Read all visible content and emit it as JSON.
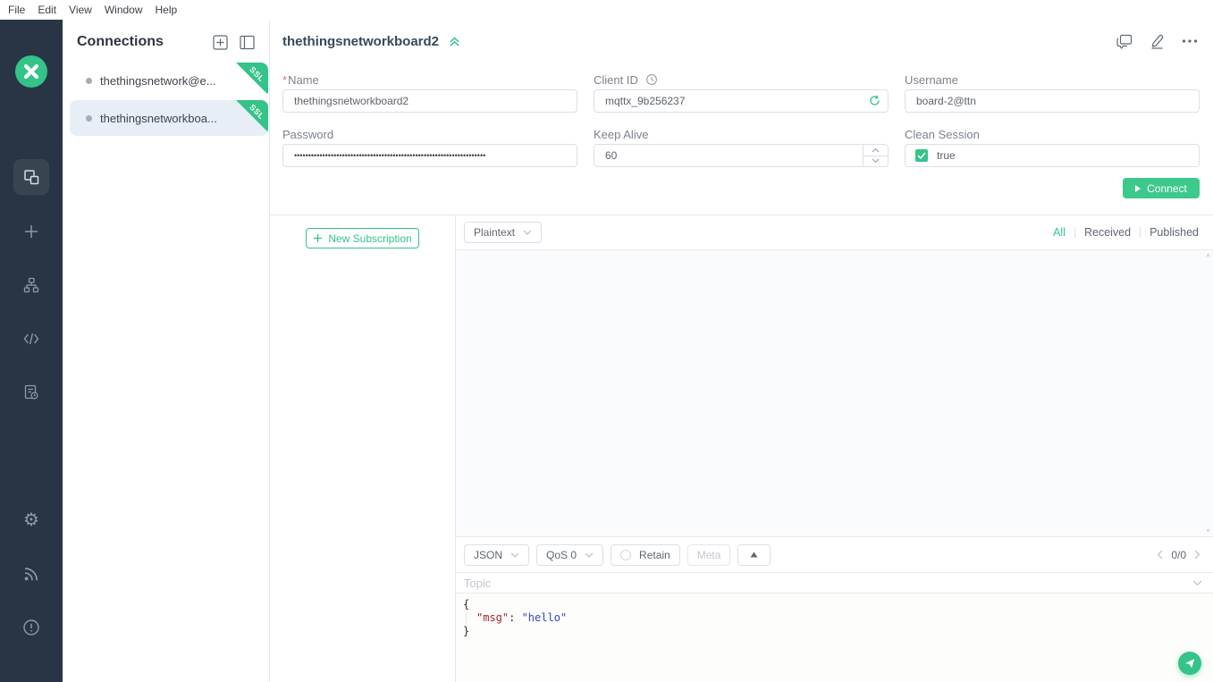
{
  "menu": {
    "items": [
      "File",
      "Edit",
      "View",
      "Window",
      "Help"
    ]
  },
  "icons": {
    "logo": "mqttx-x-mark",
    "connections": "overlapping-squares",
    "new_connection": "plus",
    "brokers": "sitemap-tree",
    "script": "code-brackets",
    "log": "document-clock",
    "settings": "gear",
    "updates": "rss-feed",
    "about": "info-circle",
    "panel_new": "plus-square",
    "panel_layout": "split-panel",
    "copy": "duplicate-windows",
    "edit": "pencil",
    "more": "ellipsis",
    "client_id_hint": "clock",
    "refresh": "refresh-arrows",
    "collapse_form": "double-chevron-up",
    "send": "paper-plane"
  },
  "connections": {
    "title": "Connections",
    "items": [
      {
        "name": "thethingsnetwork@e...",
        "badge": "SSL",
        "selected": false
      },
      {
        "name": "thethingsnetworkboa...",
        "badge": "SSL",
        "selected": true
      }
    ]
  },
  "form": {
    "title": "thethingsnetworkboard2",
    "fields": {
      "name": {
        "label": "Name",
        "required_mark": "*",
        "value": "thethingsnetworkboard2"
      },
      "client_id": {
        "label": "Client ID",
        "value": "mqttx_9b256237"
      },
      "username": {
        "label": "Username",
        "value": "board-2@ttn"
      },
      "password": {
        "label": "Password",
        "value": "••••••••••••••••••••••••••••••••••••••••••••••••••••••••••••••••••••"
      },
      "keep_alive": {
        "label": "Keep Alive",
        "value": "60"
      },
      "clean_session": {
        "label": "Clean Session",
        "value": "true"
      }
    },
    "connect_button": "Connect"
  },
  "subscriptions": {
    "new_subscription_button": "New Subscription"
  },
  "messages_toolbar": {
    "payload_format": "Plaintext",
    "filters": [
      "All",
      "Received",
      "Published"
    ],
    "active_filter": "All"
  },
  "publish_bar": {
    "payload_type": "JSON",
    "qos": "QoS 0",
    "retain_label": "Retain",
    "meta_label": "Meta",
    "pagination": "0/0"
  },
  "topic": {
    "placeholder": "Topic"
  },
  "payload_editor": {
    "line_open": "{",
    "key": "\"msg\"",
    "colon": ": ",
    "value": "\"hello\"",
    "line_close": "}"
  },
  "colors": {
    "accent_green": "#34c388",
    "sidebar_bg": "#293545",
    "selected_connection_bg": "#e7eef6",
    "json_key": "#a3262c",
    "json_value": "#2d46c5",
    "required_mark": "#f06a6a"
  }
}
